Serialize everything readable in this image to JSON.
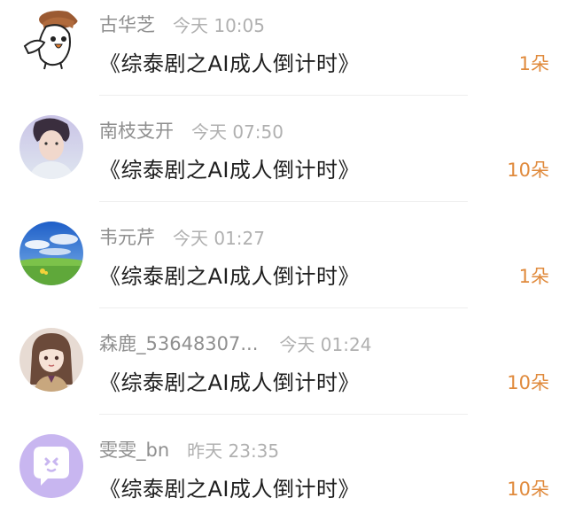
{
  "rows": [
    {
      "name": "古华芝",
      "time": "今天 10:05",
      "title": "《综泰剧之AI成人倒计时》",
      "count": "1朵",
      "avatar": "cartoon-bird-avatar"
    },
    {
      "name": "南枝支开",
      "time": "今天 07:50",
      "title": "《综泰剧之AI成人倒计时》",
      "count": "10朵",
      "avatar": "portrait-avatar"
    },
    {
      "name": "韦元芹",
      "time": "今天 01:27",
      "title": "《综泰剧之AI成人倒计时》",
      "count": "1朵",
      "avatar": "landscape-avatar"
    },
    {
      "name": "森鹿_53648307...",
      "time": "今天 01:24",
      "title": "《综泰剧之AI成人倒计时》",
      "count": "10朵",
      "avatar": "anime-girl-avatar"
    },
    {
      "name": "雯雯_bn",
      "time": "昨天 23:35",
      "title": "《综泰剧之AI成人倒计时》",
      "count": "10朵",
      "avatar": "chat-bubble-avatar"
    }
  ],
  "colors": {
    "count": "#e08a3c",
    "name": "#8f8f8f",
    "time": "#b0b0b0",
    "title": "#1f1f1f",
    "divider": "#eeeeee"
  }
}
